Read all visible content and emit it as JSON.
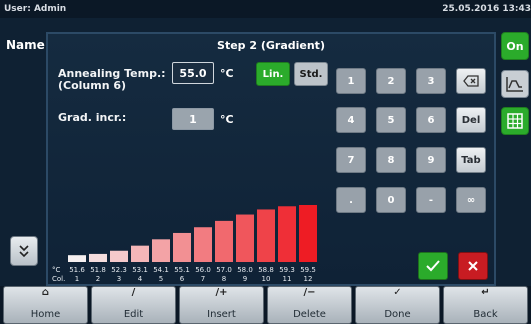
{
  "status": {
    "user": "User: Admin",
    "datetime": "25.05.2016 13:43"
  },
  "background": {
    "name_label": "Name",
    "on_label": "On",
    "down_label": "v"
  },
  "dialog": {
    "title": "Step 2 (Gradient)",
    "annealing_label_line1": "Annealing Temp.:",
    "annealing_label_line2": "(Column 6)",
    "annealing_value": "55.0",
    "annealing_unit": "°C",
    "grad_label": "Grad. incr.:",
    "grad_value": "1",
    "grad_unit": "°C",
    "mode_lin": "Lin.",
    "mode_std": "Std.",
    "keypad": [
      [
        "1",
        "2",
        "3",
        "⌫"
      ],
      [
        "4",
        "5",
        "6",
        "Del"
      ],
      [
        "7",
        "8",
        "9",
        "Tab"
      ],
      [
        ".",
        "0",
        "-",
        "∞"
      ]
    ]
  },
  "chart_data": {
    "type": "bar",
    "title": "",
    "xlabel": "Col.",
    "ylabel": "°C",
    "categories": [
      "1",
      "2",
      "3",
      "4",
      "5",
      "6",
      "7",
      "8",
      "9",
      "10",
      "11",
      "12"
    ],
    "values": [
      51.6,
      51.8,
      52.3,
      53.1,
      54.1,
      55.1,
      56.0,
      57.0,
      58.0,
      58.8,
      59.3,
      59.5
    ],
    "value_labels": [
      "51.6",
      "51.8",
      "52.3",
      "53.1",
      "54.1",
      "55.1",
      "56.0",
      "57.0",
      "58.0",
      "58.8",
      "59.3",
      "59.5"
    ],
    "row_label_values": "°C",
    "row_label_cols": "Col.",
    "colors": {
      "low": "#f6f0f0",
      "high": "#ee1c24"
    },
    "grid": false
  },
  "toolbar": [
    {
      "label": "Home",
      "icon": "home-icon"
    },
    {
      "label": "Edit",
      "icon": "edit-icon"
    },
    {
      "label": "Insert",
      "icon": "insert-icon"
    },
    {
      "label": "Delete",
      "icon": "delete-icon"
    },
    {
      "label": "Done",
      "icon": "done-icon"
    },
    {
      "label": "Back",
      "icon": "back-icon"
    }
  ]
}
